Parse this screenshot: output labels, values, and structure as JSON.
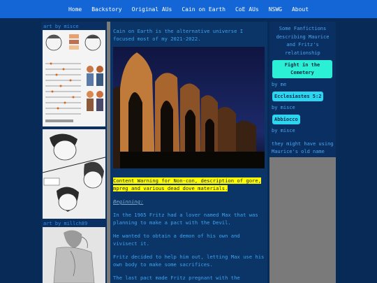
{
  "nav": [
    "Home",
    "Backstory",
    "Original AUs",
    "Cain on Earth",
    "CoE AUs",
    "NSWG",
    "About"
  ],
  "left": {
    "credit1": "art by misce",
    "credit2": "art by millch89"
  },
  "main": {
    "intro": "Cain on Earth is the alternative universe I focused most of my 2021-2022.",
    "warning": "Content Warning for Non-con, description of gore, mpreg and various dead dove materials.",
    "beginning": "Beginning:",
    "p1": "In the 1965 Fritz had a lover named Max that was planning to make a pact with the Devil.",
    "p2": "He wanted to obtain a demon of his own and vivisect it.",
    "p3": "Fritz decided to help him out, letting Max use his own body to make some sacrifices.",
    "p4": "The last pact made Fritz pregnant with the"
  },
  "right": {
    "intro": "Some Fanfictions describing Maurice and Fritz's relationship",
    "link1": "Fight in the Cemetery",
    "by1": "by me",
    "link2": "Ecclesiastes 5:2",
    "by2": "by misce",
    "link3": "Abbiocco",
    "by3": "by misce",
    "note": "they might have using Maurice's old name"
  },
  "colors": {
    "topbar": "#1466d6",
    "text": "#3ea3ee",
    "pill": "#2cf0d6",
    "warning_bg": "#ffff00"
  }
}
